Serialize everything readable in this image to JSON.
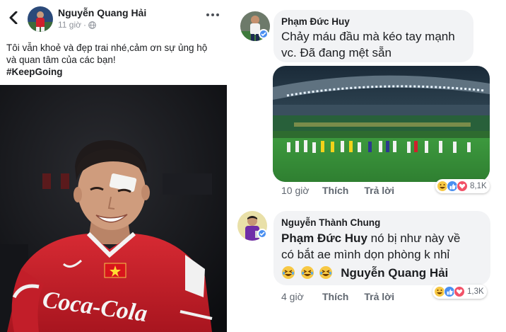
{
  "post": {
    "author": "Nguyễn Quang Hải",
    "time": "11 giờ",
    "text_line1": "Tôi vẫn khoẻ và đẹp trai nhé,cảm ơn sự ủng hộ",
    "text_line2": "và quan tâm của các bạn!",
    "hashtag": "#KeepGoing",
    "photo_jersey_text": "Coca-Cola"
  },
  "comments": [
    {
      "author": "Phạm Đức Huy",
      "text_line1": "Chảy máu đầu mà kéo tay mạnh",
      "text_line2": "vc. Đã đang mệt sẵn",
      "time": "10 giờ",
      "like_label": "Thích",
      "reply_label": "Trả lời",
      "reaction_count": "8,1K",
      "reactions": [
        "haha-icon",
        "like-icon",
        "love-icon"
      ]
    },
    {
      "author": "Nguyễn Thành Chung",
      "mention": "Phạm Đức Huy",
      "text_line1_rest": " nó bị như này về",
      "text_line2": "có bắt ae mình dọn phòng k nhỉ",
      "mention2": "Nguyễn Quang Hải",
      "time": "4 giờ",
      "like_label": "Thích",
      "reply_label": "Trả lời",
      "reaction_count": "1,3K",
      "reactions": [
        "haha-icon",
        "like-icon",
        "love-icon"
      ]
    }
  ],
  "colors": {
    "fb_blue": "#4a8ff0",
    "love_red": "#f25268",
    "haha_yellow": "#f7c844",
    "bubble_gray": "#f2f3f5",
    "jersey_red": "#d0202c"
  }
}
